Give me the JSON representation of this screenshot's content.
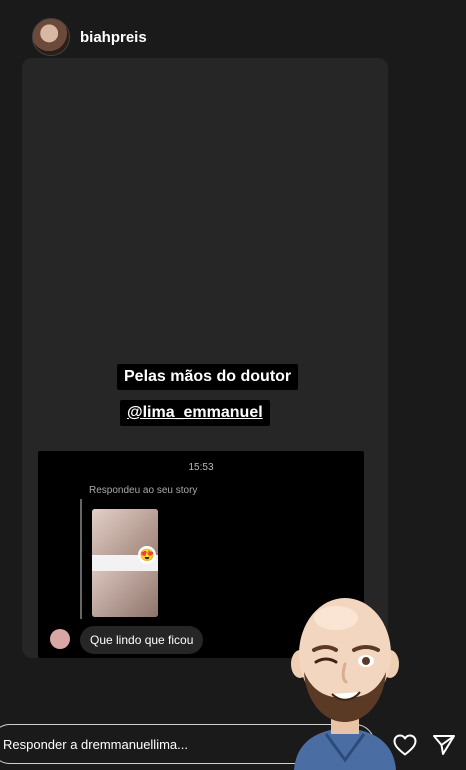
{
  "header": {
    "username": "biahpreis"
  },
  "story": {
    "caption_line1": "Pelas mãos do doutor",
    "caption_line2": "@lima_emmanuel",
    "dm": {
      "time": "15:53",
      "replied_label": "Respondeu ao seu story",
      "message": "Que lindo que ficou",
      "emoji": "😍"
    }
  },
  "footer": {
    "reply_placeholder": "Responder a dremmanuellima..."
  },
  "icons": {
    "like": "heart-icon",
    "share": "send-icon",
    "avatar": "memoji-avatar"
  }
}
